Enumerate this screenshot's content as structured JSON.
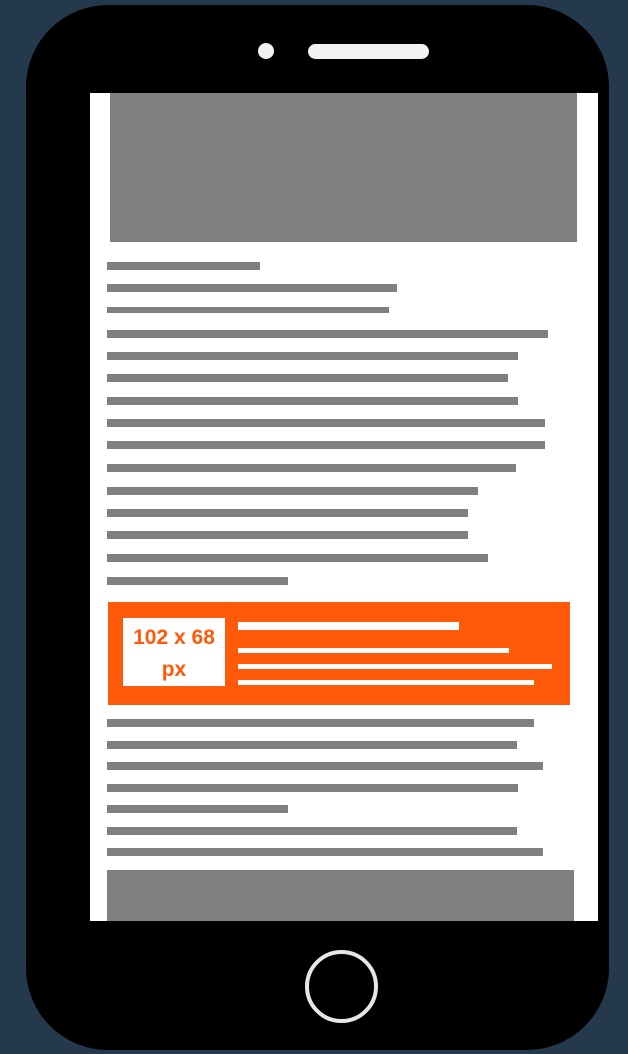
{
  "ad_banner": {
    "size_label": "102 x 68 px"
  },
  "colors": {
    "background": "#25394c",
    "phone_body": "#000000",
    "placeholder_gray": "#808080",
    "ad_accent": "#ff5a0a",
    "screen": "#ffffff"
  },
  "icons": {
    "camera": "camera-dot-icon",
    "speaker": "speaker-grille-icon",
    "home": "home-button-icon"
  }
}
